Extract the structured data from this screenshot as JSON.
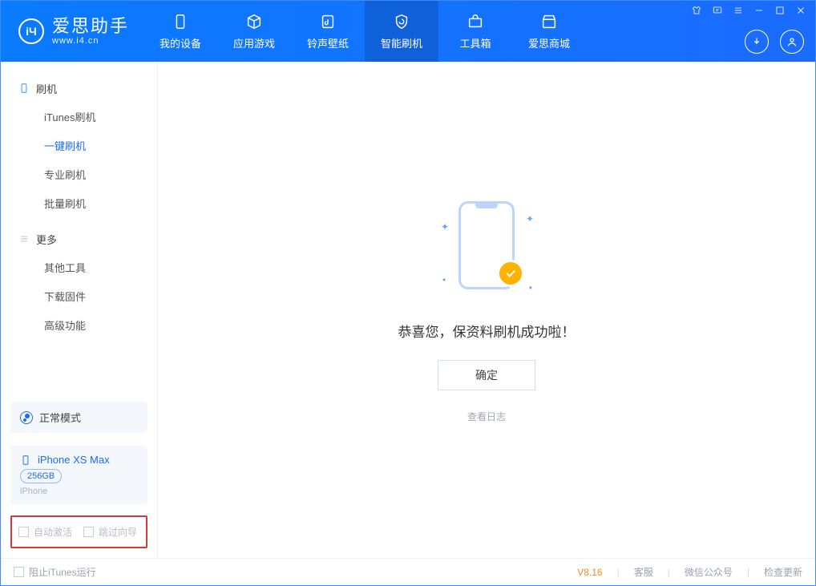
{
  "brand": {
    "name": "爱思助手",
    "url": "www.i4.cn"
  },
  "nav": {
    "items": [
      {
        "id": "device",
        "label": "我的设备"
      },
      {
        "id": "apps",
        "label": "应用游戏"
      },
      {
        "id": "ring",
        "label": "铃声壁纸"
      },
      {
        "id": "flash",
        "label": "智能刷机",
        "active": true
      },
      {
        "id": "toolbox",
        "label": "工具箱"
      },
      {
        "id": "store",
        "label": "爱思商城"
      }
    ]
  },
  "sidebar": {
    "groups": [
      {
        "id": "flash",
        "label": "刷机",
        "items": [
          {
            "id": "itunes",
            "label": "iTunes刷机"
          },
          {
            "id": "onekey",
            "label": "一键刷机",
            "active": true
          },
          {
            "id": "pro",
            "label": "专业刷机"
          },
          {
            "id": "batch",
            "label": "批量刷机"
          }
        ]
      },
      {
        "id": "more",
        "label": "更多",
        "items": [
          {
            "id": "other",
            "label": "其他工具"
          },
          {
            "id": "fw",
            "label": "下载固件"
          },
          {
            "id": "adv",
            "label": "高级功能"
          }
        ]
      }
    ],
    "mode": {
      "label": "正常模式"
    },
    "device": {
      "name": "iPhone XS Max",
      "capacity": "256GB",
      "type": "iPhone"
    },
    "options": {
      "auto_activate": "自动激活",
      "skip_guide": "跳过向导"
    }
  },
  "main": {
    "success_text": "恭喜您，保资料刷机成功啦！",
    "ok_label": "确定",
    "log_link": "查看日志"
  },
  "footer": {
    "block_itunes": "阻止iTunes运行",
    "version": "V8.16",
    "links": {
      "service": "客服",
      "wechat": "微信公众号",
      "update": "检查更新"
    }
  }
}
